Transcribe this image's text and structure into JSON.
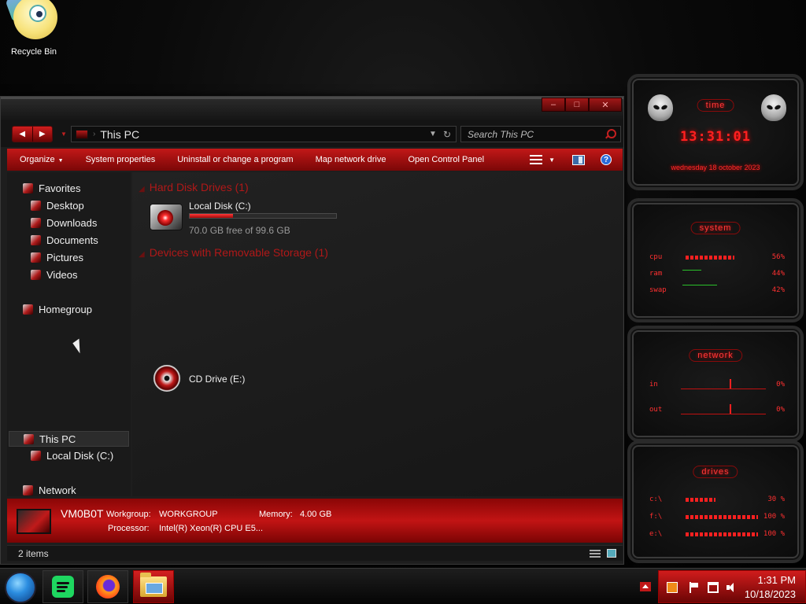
{
  "desktop": {
    "recycle_bin_label": "Recycle Bin"
  },
  "explorer": {
    "address": "This PC",
    "search_placeholder": "Search This PC",
    "toolbar": {
      "organize": "Organize",
      "system_properties": "System properties",
      "uninstall": "Uninstall or change a program",
      "map_drive": "Map network drive",
      "control_panel": "Open Control Panel"
    },
    "nav": {
      "favorites": "Favorites",
      "desktop": "Desktop",
      "downloads": "Downloads",
      "documents": "Documents",
      "pictures": "Pictures",
      "videos": "Videos",
      "homegroup": "Homegroup",
      "this_pc": "This PC",
      "local_disk": "Local Disk (C:)",
      "network": "Network"
    },
    "groups": {
      "hard_disks": "Hard Disk Drives (1)",
      "removable": "Devices with Removable Storage (1)"
    },
    "drives": {
      "c_name": "Local Disk (C:)",
      "c_free": "70.0 GB free of 99.6 GB",
      "c_used_fraction": 0.297,
      "e_name": "CD Drive (E:)"
    },
    "details": {
      "pc_name": "VM0B0T",
      "workgroup_label": "Workgroup:",
      "workgroup_value": "WORKGROUP",
      "memory_label": "Memory:",
      "memory_value": "4.00 GB",
      "processor_label": "Processor:",
      "processor_value": "Intel(R) Xeon(R) CPU E5..."
    },
    "status": {
      "item_count": "2 items"
    }
  },
  "gadgets": {
    "time": {
      "title": "time",
      "clock": "13:31:01",
      "date": "wednesday 18 october 2023"
    },
    "system": {
      "title": "system",
      "cpu_label": "cpu",
      "cpu_value": "56%",
      "ram_label": "ram",
      "ram_value": "44%",
      "swap_label": "swap",
      "swap_value": "42%"
    },
    "network": {
      "title": "network",
      "in_label": "in",
      "in_value": "0%",
      "out_label": "out",
      "out_value": "0%"
    },
    "drives": {
      "title": "drives",
      "c_label": "c:\\",
      "c_value": "30 %",
      "f_label": "f:\\",
      "f_value": "100 %",
      "e_label": "e:\\",
      "e_value": "100 %"
    }
  },
  "taskbar": {
    "time": "1:31 PM",
    "date": "10/18/2023"
  },
  "colors": {
    "accent": "#c21818",
    "accent_dark": "#6a0505",
    "glow": "#ff2020"
  }
}
